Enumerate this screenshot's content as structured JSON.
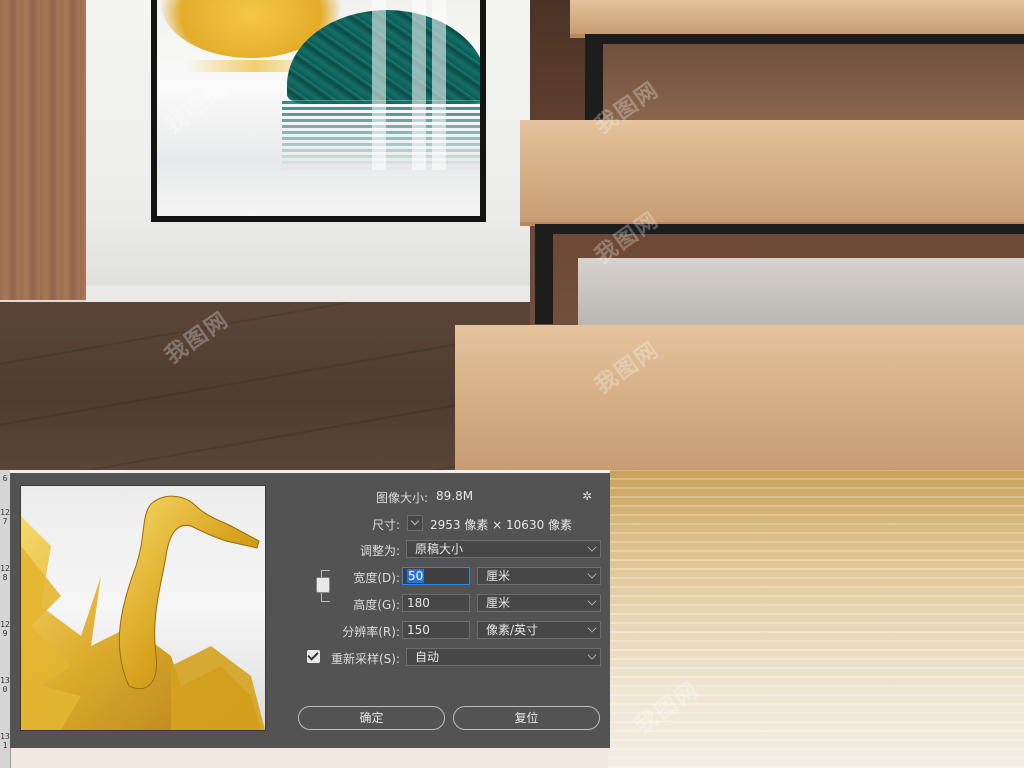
{
  "dialog": {
    "image_size_label": "图像大小:",
    "image_size_value": "89.8M",
    "dimensions_label": "尺寸:",
    "dimensions_value": "2953 像素 × 10630 像素",
    "fit_to_label": "调整为:",
    "fit_to_value": "原稿大小",
    "width_label": "宽度(D):",
    "width_value": "50",
    "width_unit": "厘米",
    "height_label": "高度(G):",
    "height_value": "180",
    "height_unit": "厘米",
    "resolution_label": "分辨率(R):",
    "resolution_value": "150",
    "resolution_unit": "像素/英寸",
    "resample_label": "重新采样(S):",
    "resample_checked": true,
    "resample_value": "自动",
    "ok_button": "确定",
    "reset_button": "复位"
  },
  "ruler": {
    "marks": [
      "6",
      "127",
      "128",
      "129",
      "130",
      "131"
    ]
  },
  "watermark_text": "我图网",
  "icons": [
    "gear-icon",
    "link-icon",
    "chevron-down-icon",
    "checkbox-icon"
  ],
  "colors": {
    "dialog_bg": "#535353",
    "field_bg": "#474747",
    "selection_blue": "#2b73d8",
    "text": "#dcdcdc"
  }
}
